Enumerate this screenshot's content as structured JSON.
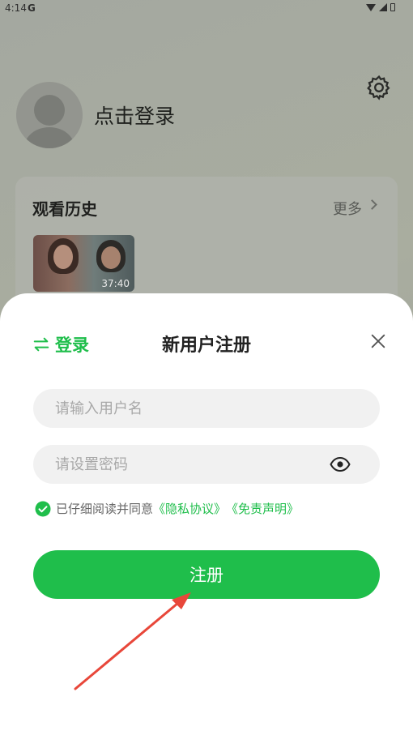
{
  "status_bar": {
    "time": "4:14",
    "carrier_icon": "G"
  },
  "background": {
    "login_prompt": "点击登录",
    "history": {
      "title": "观看历史",
      "more_label": "更多",
      "items": [
        {
          "duration": "37:40"
        }
      ]
    }
  },
  "sheet": {
    "switch_label": "登录",
    "title": "新用户注册",
    "username": {
      "value": "",
      "placeholder": "请输入用户名"
    },
    "password": {
      "value": "",
      "placeholder": "请设置密码"
    },
    "agreement": {
      "checked": true,
      "text": "已仔细阅读并同意",
      "privacy_link": "《隐私协议》",
      "disclaimer_link": "《免责声明》"
    },
    "register_label": "注册"
  },
  "colors": {
    "accent": "#1fbe4b",
    "annotation_arrow": "#e8473a"
  },
  "icons": [
    "wifi-icon",
    "signal-icon",
    "battery-icon",
    "gear-icon",
    "swap-icon",
    "close-icon",
    "eye-icon",
    "check-circle-icon"
  ]
}
